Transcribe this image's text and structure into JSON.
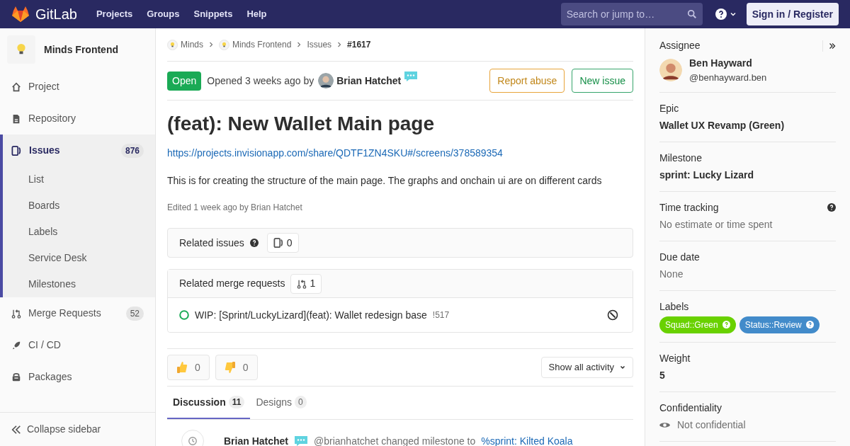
{
  "nav": {
    "logo_text": "GitLab",
    "links": [
      "Projects",
      "Groups",
      "Snippets",
      "Help"
    ],
    "search": {
      "placeholder": "Search or jump to…"
    },
    "sign_in": "Sign in / Register"
  },
  "sidebar": {
    "project_name": "Minds Frontend",
    "items": [
      {
        "kind": "home",
        "label": "Project",
        "selected": false
      },
      {
        "kind": "file",
        "label": "Repository",
        "selected": false
      },
      {
        "kind": "issues",
        "label": "Issues",
        "count": "876",
        "selected": true,
        "children": [
          {
            "label": "List"
          },
          {
            "label": "Boards"
          },
          {
            "label": "Labels"
          },
          {
            "label": "Service Desk"
          },
          {
            "label": "Milestones"
          }
        ]
      },
      {
        "kind": "merge",
        "label": "Merge Requests",
        "count": "52",
        "selected": false
      },
      {
        "kind": "rocket",
        "label": "CI / CD",
        "selected": false
      },
      {
        "kind": "package",
        "label": "Packages",
        "selected": false
      }
    ],
    "collapse": "Collapse sidebar"
  },
  "breadcrumbs": [
    {
      "label": "Minds",
      "avatar": true
    },
    {
      "label": "Minds Frontend",
      "avatar": true
    },
    {
      "label": "Issues",
      "avatar": false
    },
    {
      "label": "#1617",
      "avatar": false,
      "current": true
    }
  ],
  "issue": {
    "status": "Open",
    "opened": "Opened 3 weeks ago by",
    "author": "Brian Hatchet",
    "buttons": [
      {
        "kind": "warning",
        "label": "Report abuse"
      },
      {
        "kind": "success",
        "label": "New issue"
      }
    ],
    "title": "(feat): New Wallet Main page",
    "link": "https://projects.invisionapp.com/share/QDTF1ZN4SKU#/screens/378589354",
    "description": "This is for creating the structure of the main page. The graphs and onchain ui are on different cards",
    "edited": "Edited 1 week ago by Brian Hatchet"
  },
  "related_issues": {
    "title": "Related issues",
    "count": "0"
  },
  "related_merge_requests": {
    "title": "Related merge requests",
    "count": "1",
    "items": [
      {
        "title": "WIP: [Sprint/LuckyLizard](feat): Wallet redesign base",
        "ref": "!517"
      }
    ]
  },
  "reactions": [
    {
      "kind": "thumbs_up",
      "count": "0"
    },
    {
      "kind": "thumbs_down",
      "count": "0"
    }
  ],
  "activity_filter": "Show all activity",
  "tabs": [
    {
      "label": "Discussion",
      "count": "11",
      "selected": true
    },
    {
      "label": "Designs",
      "count": "0",
      "selected": false
    }
  ],
  "activity": {
    "author": "Brian Hatchet",
    "text": "@brianhatchet changed milestone to",
    "link": "%sprint: Kilted Koala"
  },
  "details": {
    "assignee": {
      "label": "Assignee",
      "name": "Ben Hayward",
      "username": "@benhayward.ben"
    },
    "sections": [
      {
        "kind": "bold",
        "label": "Epic",
        "value": "Wallet UX Revamp (Green)"
      },
      {
        "kind": "bold",
        "label": "Milestone",
        "value": "sprint: Lucky Lizard"
      },
      {
        "kind": "muted",
        "label": "Time tracking",
        "value": "No estimate or time spent",
        "help": true
      },
      {
        "kind": "muted",
        "label": "Due date",
        "value": "None"
      },
      {
        "kind": "labels",
        "label": "Labels",
        "labels": [
          {
            "text": "Squad::Green",
            "color": "#69d100"
          },
          {
            "text": "Status::Review",
            "color": "#428bca"
          }
        ]
      },
      {
        "kind": "bold",
        "label": "Weight",
        "value": "5"
      },
      {
        "kind": "eye",
        "label": "Confidentiality",
        "value": "Not confidential"
      }
    ]
  }
}
